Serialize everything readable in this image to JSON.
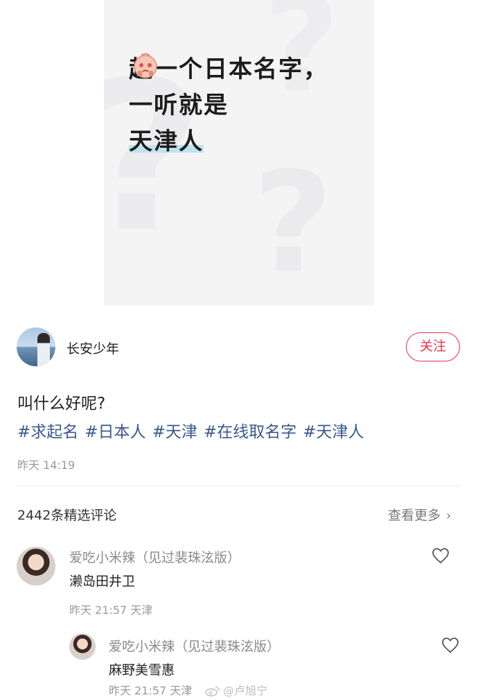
{
  "cover": {
    "title_line1": "起一个日本名字，",
    "title_line2": "一听就是",
    "title_line3": "天津人",
    "emoji": "pleading-face-emoji"
  },
  "post": {
    "author": "长安少年",
    "follow_label": "关注",
    "text": "叫什么好呢?",
    "tags": [
      "#求起名",
      "#日本人",
      "#天津",
      "#在线取名字",
      "#天津人"
    ],
    "time": "昨天 14:19"
  },
  "comments_header": {
    "count": "2442条精选评论",
    "see_more": "查看更多",
    "chevron": "›"
  },
  "comments": [
    {
      "user": "爱吃小米辣（见过裴珠泫版）",
      "text": "濑岛田井卫",
      "meta": "昨天 21:57 天津"
    },
    {
      "user": "爱吃小米辣（见过裴珠泫版）",
      "text": "麻野美雪惠",
      "meta": "昨天 21:57 天津"
    }
  ],
  "watermark": "@卢旭宁",
  "colors": {
    "accent_red": "#e5344f",
    "tag_blue": "#3a5a8c",
    "highlight": "#bfe2ee"
  }
}
